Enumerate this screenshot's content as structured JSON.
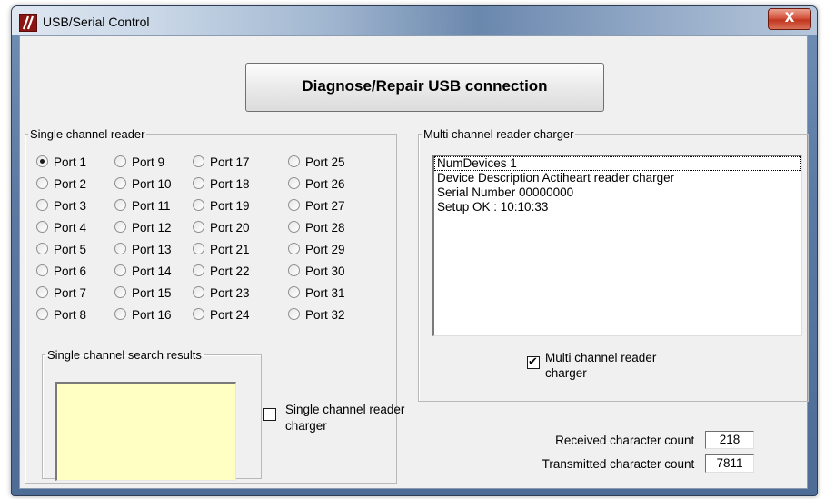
{
  "window": {
    "title": "USB/Serial Control",
    "close_symbol": "X"
  },
  "diagnose_button": "Diagnose/Repair USB connection",
  "single_channel": {
    "legend": "Single channel reader",
    "selected_port": "Port 1",
    "ports": [
      [
        "Port 1",
        "Port 9",
        "Port 17",
        "Port 25"
      ],
      [
        "Port 2",
        "Port 10",
        "Port 18",
        "Port 26"
      ],
      [
        "Port 3",
        "Port 11",
        "Port 19",
        "Port 27"
      ],
      [
        "Port 4",
        "Port 12",
        "Port 20",
        "Port 28"
      ],
      [
        "Port 5",
        "Port 13",
        "Port 21",
        "Port 29"
      ],
      [
        "Port 6",
        "Port 14",
        "Port 22",
        "Port 30"
      ],
      [
        "Port 7",
        "Port 15",
        "Port 23",
        "Port 31"
      ],
      [
        "Port 8",
        "Port 16",
        "Port 24",
        "Port 32"
      ]
    ],
    "search_results_legend": "Single channel search results",
    "search_results": "",
    "charger_checkbox_label": "Single channel reader charger",
    "charger_checked": false
  },
  "multi_channel": {
    "legend": "Multi channel reader charger",
    "list_items": [
      "NumDevices 1",
      "Device Description Actiheart reader charger",
      "Serial Number 00000000",
      "Setup OK : 10:10:33"
    ],
    "charger_checkbox_label": "Multi channel reader charger",
    "charger_checked": true
  },
  "counts": {
    "received_label": "Received character count",
    "received_value": "218",
    "transmitted_label": "Transmitted character count",
    "transmitted_value": "7811"
  },
  "icons": {
    "app": "app-logo-icon",
    "close": "close-icon"
  }
}
